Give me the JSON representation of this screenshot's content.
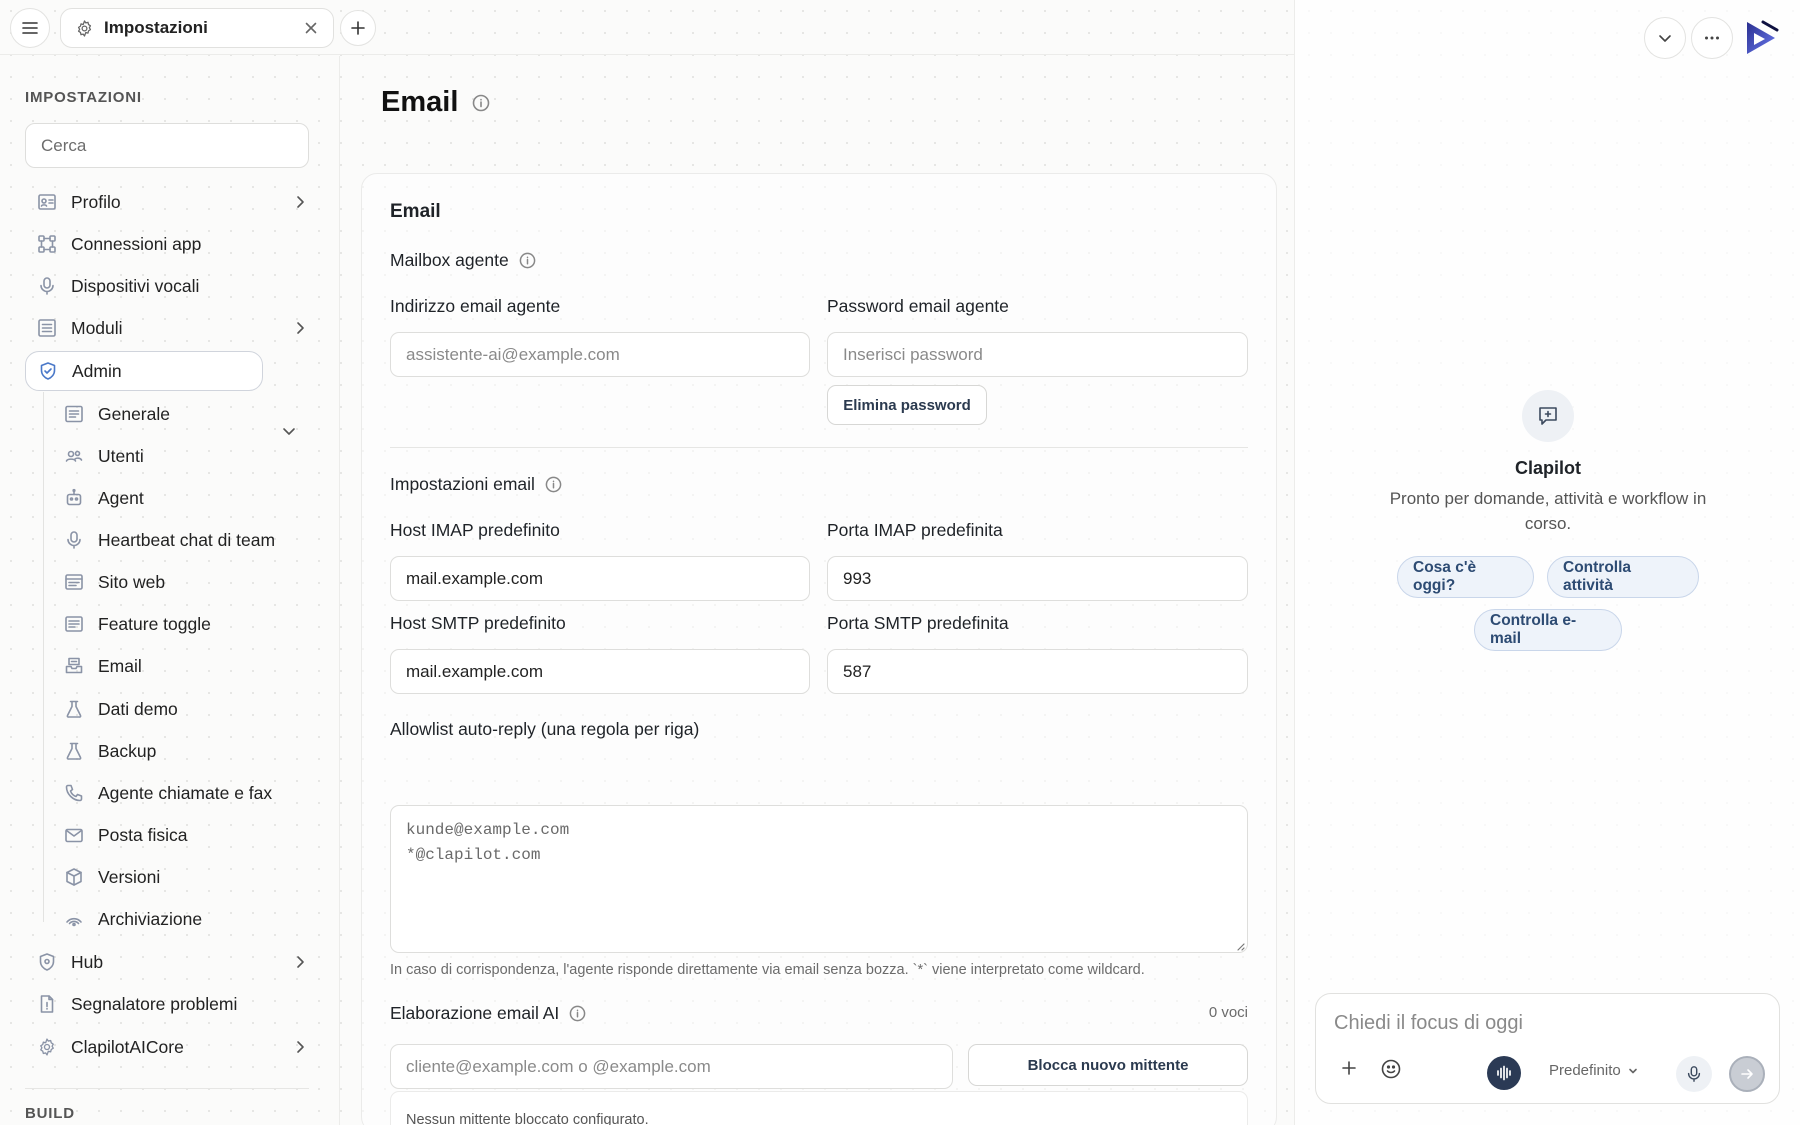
{
  "tabs": [
    {
      "label": "Impostazioni",
      "icon": "gear-icon"
    }
  ],
  "sidebar": {
    "section_title": "IMPOSTAZIONI",
    "search_placeholder": "Cerca",
    "items": [
      {
        "label": "Profilo",
        "icon": "profile-card-icon",
        "chevron": true
      },
      {
        "label": "Connessioni app",
        "icon": "connections-icon"
      },
      {
        "label": "Dispositivi vocali",
        "icon": "microphone-icon"
      },
      {
        "label": "Moduli",
        "icon": "modules-icon",
        "chevron": true
      },
      {
        "label": "Admin",
        "icon": "shield-icon",
        "expanded": true,
        "active": true
      }
    ],
    "admin_items": [
      {
        "label": "Generale",
        "icon": "list-icon"
      },
      {
        "label": "Utenti",
        "icon": "users-icon"
      },
      {
        "label": "Agent",
        "icon": "robot-icon"
      },
      {
        "label": "Heartbeat chat di team",
        "icon": "microphone-icon"
      },
      {
        "label": "Sito web",
        "icon": "browser-icon"
      },
      {
        "label": "Feature toggle",
        "icon": "list-icon"
      },
      {
        "label": "Email",
        "icon": "inbox-icon"
      },
      {
        "label": "Dati demo",
        "icon": "flask-icon"
      },
      {
        "label": "Backup",
        "icon": "flask-icon"
      },
      {
        "label": "Agente chiamate e fax",
        "icon": "phone-icon"
      },
      {
        "label": "Posta fisica",
        "icon": "mail-icon"
      },
      {
        "label": "Versioni",
        "icon": "box-icon"
      },
      {
        "label": "Archiviazione",
        "icon": "signal-icon"
      }
    ],
    "bottom_items": [
      {
        "label": "Hub",
        "icon": "shield-icon",
        "chevron": true
      },
      {
        "label": "Segnalatore problemi",
        "icon": "document-icon"
      },
      {
        "label": "ClapilotAICore",
        "icon": "gear-icon",
        "chevron": true
      }
    ],
    "build_title": "BUILD"
  },
  "main": {
    "page_title": "Email",
    "card_title": "Email",
    "mailbox": {
      "title": "Mailbox agente",
      "address_label": "Indirizzo email agente",
      "address_placeholder": "assistente-ai@example.com",
      "password_label": "Password email agente",
      "password_placeholder": "Inserisci password",
      "delete_password_button": "Elimina password"
    },
    "settings": {
      "title": "Impostazioni email",
      "imap_host_label": "Host IMAP predefinito",
      "imap_host_value": "mail.example.com",
      "imap_port_label": "Porta IMAP predefinita",
      "imap_port_value": "993",
      "smtp_host_label": "Host SMTP predefinito",
      "smtp_host_value": "mail.example.com",
      "smtp_port_label": "Porta SMTP predefinita",
      "smtp_port_value": "587"
    },
    "allowlist": {
      "label": "Allowlist auto-reply (una regola per riga)",
      "placeholder": "kunde@example.com\n*@clapilot.com",
      "hint": "In caso di corrispondenza, l'agente risponde direttamente via email senza bozza. `*` viene interpretato come wildcard."
    },
    "ai_processing": {
      "title": "Elaborazione email AI",
      "count": "0 voci",
      "sender_placeholder": "cliente@example.com o @example.com",
      "block_button": "Blocca nuovo mittente",
      "empty_text": "Nessun mittente bloccato configurato."
    }
  },
  "assistant": {
    "name": "Clapilot",
    "description": "Pronto per domande, attività e workflow in corso.",
    "chips": [
      "Cosa c'è oggi?",
      "Controlla attività",
      "Controlla e-mail"
    ],
    "input_placeholder": "Chiedi il focus di oggi",
    "model": "Predefinito"
  },
  "colors": {
    "accent": "#4a78c8",
    "chip_bg": "#eef3fa",
    "voice_btn": "#2b3a55"
  }
}
